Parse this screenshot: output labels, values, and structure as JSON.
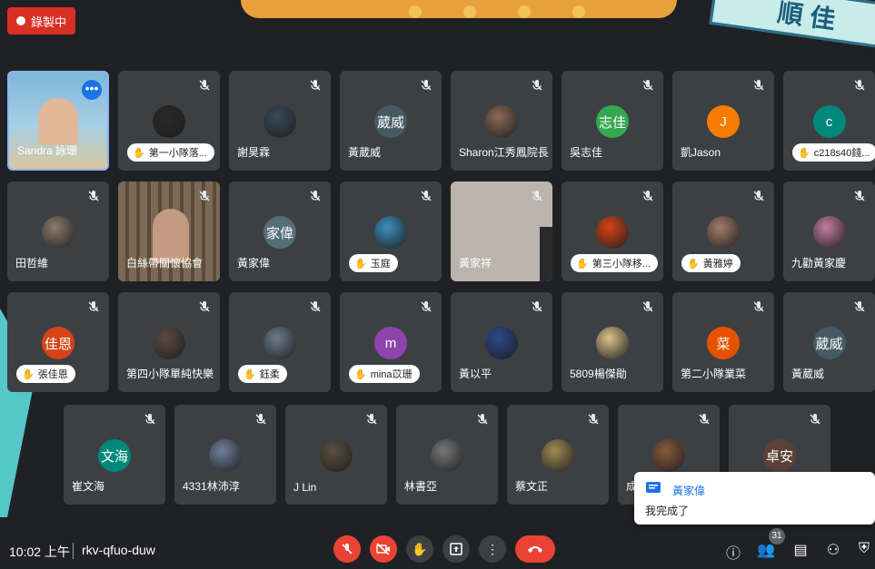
{
  "recording": {
    "label": "錄製中"
  },
  "tiles": [
    {
      "name": "Sandra 詠珊",
      "type": "self",
      "row": 0,
      "col": 0
    },
    {
      "name": "第一小隊落...",
      "type": "pill",
      "avatar_color": "#2a2a2a",
      "initial": "",
      "row": 0,
      "col": 1
    },
    {
      "name": "謝昊霖",
      "type": "avatar",
      "avatar_color": "#3a4a5c",
      "initial": "",
      "row": 0,
      "col": 2
    },
    {
      "name": "黃葳威",
      "type": "avatar",
      "avatar_color": "#455a64",
      "initial": "葳威",
      "row": 0,
      "col": 3
    },
    {
      "name": "Sharon江秀鳳院長",
      "type": "avatar",
      "avatar_color": "#8a6a55",
      "initial": "",
      "row": 0,
      "col": 4
    },
    {
      "name": "吳志佳",
      "type": "avatar",
      "avatar_color": "#33a852",
      "initial": "志佳",
      "row": 0,
      "col": 5
    },
    {
      "name": "凱Jason",
      "type": "avatar",
      "avatar_color": "#f57c00",
      "initial": "J",
      "row": 0,
      "col": 6
    },
    {
      "name": "c218s40錢...",
      "type": "pill",
      "avatar_color": "#00897b",
      "initial": "c",
      "row": 0,
      "col": 7
    },
    {
      "name": "田哲維",
      "type": "avatar",
      "avatar_color": "#8d7b6a",
      "initial": "",
      "row": 1,
      "col": 0
    },
    {
      "name": "白絲帶關懷協會",
      "type": "photo",
      "row": 1,
      "col": 1
    },
    {
      "name": "黃家偉",
      "type": "avatar",
      "avatar_color": "#546e7a",
      "initial": "家偉",
      "row": 1,
      "col": 2
    },
    {
      "name": "玉庭",
      "type": "pill",
      "avatar_color": "#3b8fbf",
      "initial": "",
      "row": 1,
      "col": 3
    },
    {
      "name": "黃家祥",
      "type": "wall",
      "row": 1,
      "col": 4
    },
    {
      "name": "第三小隊移...",
      "type": "pill",
      "avatar_color": "#d84315",
      "initial": "",
      "row": 1,
      "col": 5
    },
    {
      "name": "黃雅婷",
      "type": "pill",
      "avatar_color": "#a17c6b",
      "initial": "",
      "row": 1,
      "col": 6
    },
    {
      "name": "九勸黃家慶",
      "type": "avatar",
      "avatar_color": "#c27ba0",
      "initial": "",
      "row": 1,
      "col": 7
    },
    {
      "name": "張佳恩",
      "type": "pill",
      "avatar_color": "#d84315",
      "initial": "佳恩",
      "row": 2,
      "col": 0
    },
    {
      "name": "第四小隊單純快樂",
      "type": "avatar",
      "avatar_color": "#5d4a3f",
      "initial": "",
      "row": 2,
      "col": 1
    },
    {
      "name": "鈺柔",
      "type": "pill",
      "avatar_color": "#6b7b8c",
      "initial": "",
      "row": 2,
      "col": 2
    },
    {
      "name": "mina苡珊",
      "type": "pill",
      "avatar_color": "#8e44ad",
      "initial": "m",
      "row": 2,
      "col": 3
    },
    {
      "name": "黃以平",
      "type": "avatar",
      "avatar_color": "#2b4a8a",
      "initial": "",
      "row": 2,
      "col": 4
    },
    {
      "name": "5809楊傑勛",
      "type": "avatar",
      "avatar_color": "#d9c38a",
      "initial": "",
      "row": 2,
      "col": 5
    },
    {
      "name": "第二小隊業菜",
      "type": "avatar",
      "avatar_color": "#e65100",
      "initial": "菜",
      "row": 2,
      "col": 6
    },
    {
      "name": "黃葳威",
      "type": "avatar",
      "avatar_color": "#455a64",
      "initial": "葳威",
      "row": 2,
      "col": 7
    },
    {
      "name": "崔文海",
      "type": "avatar",
      "avatar_color": "#00897b",
      "initial": "文海",
      "row": 3,
      "col": 0
    },
    {
      "name": "4331林沛淳",
      "type": "avatar",
      "avatar_color": "#6f7f99",
      "initial": "",
      "row": 3,
      "col": 1
    },
    {
      "name": "J Lin",
      "type": "avatar",
      "avatar_color": "#5b5040",
      "initial": "",
      "row": 3,
      "col": 2
    },
    {
      "name": "林書亞",
      "type": "avatar",
      "avatar_color": "#777777",
      "initial": "",
      "row": 3,
      "col": 3
    },
    {
      "name": "蔡文正",
      "type": "avatar",
      "avatar_color": "#a08a50",
      "initial": "",
      "row": 3,
      "col": 4
    },
    {
      "name": "成",
      "type": "avatar",
      "avatar_color": "#8a5a3a",
      "initial": "",
      "row": 3,
      "col": 5
    },
    {
      "name": "",
      "type": "avatar",
      "avatar_color": "#5d4037",
      "initial": "卓安",
      "row": 3,
      "col": 6
    }
  ],
  "chat": {
    "from": "黃家偉",
    "message": "我完成了"
  },
  "bottom": {
    "time": "10:02 上午",
    "meeting_code": "rkv-qfuo-duw",
    "participants_count": "31"
  },
  "colors": {
    "bg": "#202124",
    "tile": "#3c4043",
    "red": "#ea4335",
    "accent": "#1a73e8"
  }
}
